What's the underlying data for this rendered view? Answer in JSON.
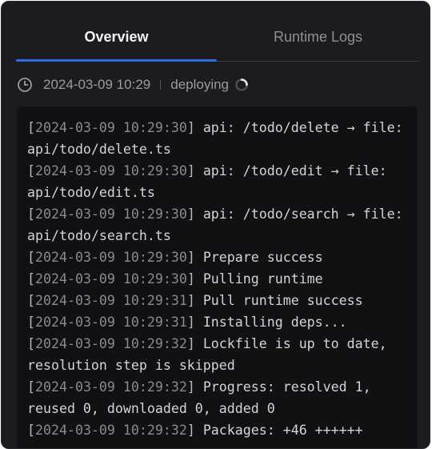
{
  "tabs": [
    {
      "label": "Overview",
      "active": true
    },
    {
      "label": "Runtime Logs",
      "active": false
    }
  ],
  "deployment": {
    "timestamp": "2024-03-09 10:29",
    "status": "deploying"
  },
  "logs": [
    {
      "time": "2024-03-09 10:29:30",
      "message": "api: /todo/delete → file: api/todo/delete.ts"
    },
    {
      "time": "2024-03-09 10:29:30",
      "message": "api: /todo/edit → file: api/todo/edit.ts"
    },
    {
      "time": "2024-03-09 10:29:30",
      "message": "api: /todo/search → file: api/todo/search.ts"
    },
    {
      "time": "2024-03-09 10:29:30",
      "message": "Prepare success"
    },
    {
      "time": "2024-03-09 10:29:30",
      "message": "Pulling runtime"
    },
    {
      "time": "2024-03-09 10:29:31",
      "message": "Pull runtime success"
    },
    {
      "time": "2024-03-09 10:29:31",
      "message": "Installing deps..."
    },
    {
      "time": "2024-03-09 10:29:32",
      "message": "Lockfile is up to date, resolution step is skipped"
    },
    {
      "time": "2024-03-09 10:29:32",
      "message": "Progress: resolved 1, reused 0, downloaded 0, added 0"
    },
    {
      "time": "2024-03-09 10:29:32",
      "message": "Packages: +46 ++++++"
    }
  ],
  "colors": {
    "accent": "#2f6fe0",
    "background": "#1c1c20",
    "console": "#111114"
  }
}
